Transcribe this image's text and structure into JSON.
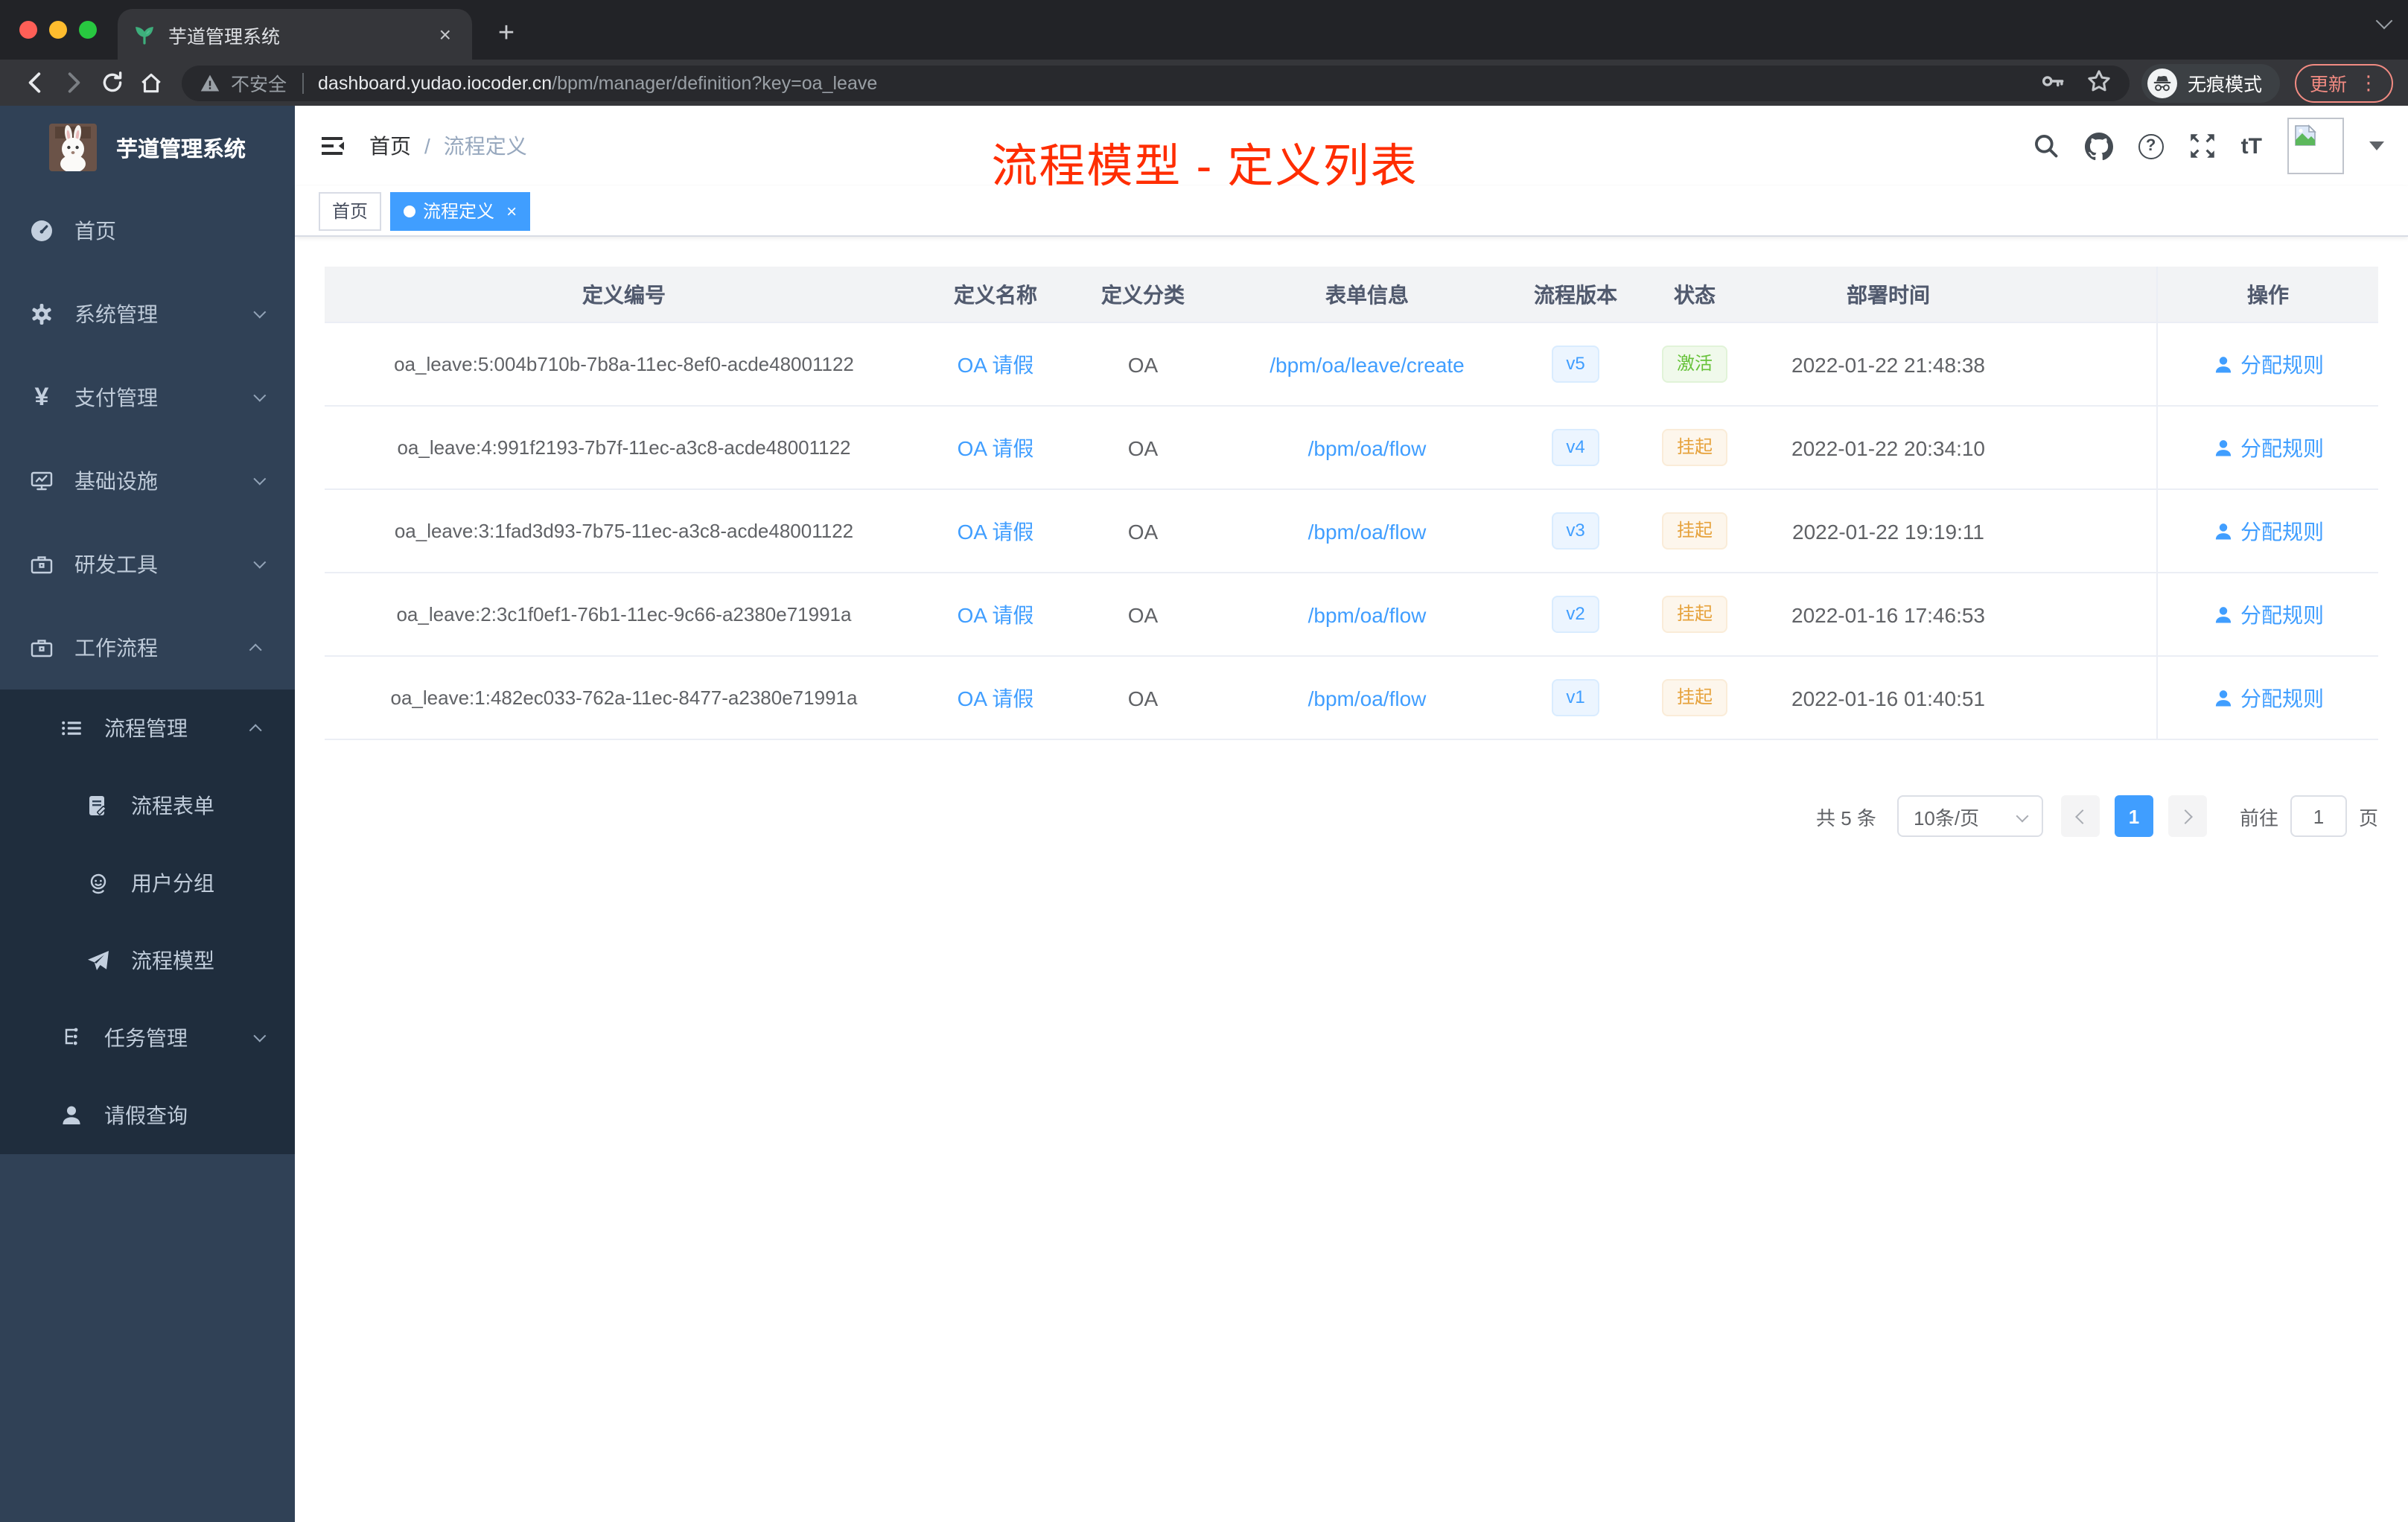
{
  "browser": {
    "tab_title": "芋道管理系统",
    "new_tab_label": "+",
    "close_tab_label": "×",
    "address": {
      "warning_label": "不安全",
      "host": "dashboard.yudao.iocoder.cn",
      "path": "/bpm/manager/definition?key=oa_leave"
    },
    "incognito_label": "无痕模式",
    "update_label": "更新",
    "menu_dots": "⋮"
  },
  "sidebar": {
    "logo_title": "芋道管理系统",
    "items": [
      {
        "label": "首页",
        "icon": "dashboard-icon",
        "level": 1
      },
      {
        "label": "系统管理",
        "icon": "gear-icon",
        "level": 1,
        "chevron": "down"
      },
      {
        "label": "支付管理",
        "icon": "yen-icon",
        "level": 1,
        "chevron": "down"
      },
      {
        "label": "基础设施",
        "icon": "monitor-icon",
        "level": 1,
        "chevron": "down"
      },
      {
        "label": "研发工具",
        "icon": "toolbox-icon",
        "level": 1,
        "chevron": "down"
      },
      {
        "label": "工作流程",
        "icon": "briefcase-icon",
        "level": 1,
        "chevron": "up"
      },
      {
        "label": "流程管理",
        "icon": "list-icon",
        "level": 2,
        "chevron": "up"
      },
      {
        "label": "流程表单",
        "icon": "form-icon",
        "level": 3
      },
      {
        "label": "用户分组",
        "icon": "user-group-icon",
        "level": 3
      },
      {
        "label": "流程模型",
        "icon": "paper-plane-icon",
        "level": 3
      },
      {
        "label": "任务管理",
        "icon": "tasks-icon",
        "level": 2,
        "chevron": "down"
      },
      {
        "label": "请假查询",
        "icon": "person-icon",
        "level": 2
      }
    ]
  },
  "header": {
    "breadcrumb": {
      "home": "首页",
      "separator": "/",
      "current": "流程定义"
    },
    "annotation": "流程模型 - 定义列表"
  },
  "tags": {
    "items": [
      {
        "label": "首页",
        "active": false
      },
      {
        "label": "流程定义",
        "active": true
      }
    ]
  },
  "table": {
    "columns": {
      "id": "定义编号",
      "name": "定义名称",
      "category": "定义分类",
      "form": "表单信息",
      "version": "流程版本",
      "status": "状态",
      "deploy_time": "部署时间",
      "action": "操作"
    },
    "action_label": "分配规则",
    "rows": [
      {
        "id": "oa_leave:5:004b710b-7b8a-11ec-8ef0-acde48001122",
        "name": "OA 请假",
        "category": "OA",
        "form": "/bpm/oa/leave/create",
        "version": "v5",
        "status": {
          "label": "激活",
          "type": "success"
        },
        "time": "2022-01-22 21:48:38"
      },
      {
        "id": "oa_leave:4:991f2193-7b7f-11ec-a3c8-acde48001122",
        "name": "OA 请假",
        "category": "OA",
        "form": "/bpm/oa/flow",
        "version": "v4",
        "status": {
          "label": "挂起",
          "type": "warning"
        },
        "time": "2022-01-22 20:34:10"
      },
      {
        "id": "oa_leave:3:1fad3d93-7b75-11ec-a3c8-acde48001122",
        "name": "OA 请假",
        "category": "OA",
        "form": "/bpm/oa/flow",
        "version": "v3",
        "status": {
          "label": "挂起",
          "type": "warning"
        },
        "time": "2022-01-22 19:19:11"
      },
      {
        "id": "oa_leave:2:3c1f0ef1-76b1-11ec-9c66-a2380e71991a",
        "name": "OA 请假",
        "category": "OA",
        "form": "/bpm/oa/flow",
        "version": "v2",
        "status": {
          "label": "挂起",
          "type": "warning"
        },
        "time": "2022-01-16 17:46:53"
      },
      {
        "id": "oa_leave:1:482ec033-762a-11ec-8477-a2380e71991a",
        "name": "OA 请假",
        "category": "OA",
        "form": "/bpm/oa/flow",
        "version": "v1",
        "status": {
          "label": "挂起",
          "type": "warning"
        },
        "time": "2022-01-16 01:40:51"
      }
    ]
  },
  "pagination": {
    "total": "共 5 条",
    "page_size": "10条/页",
    "page": "1",
    "goto": "前往",
    "goto_value": "1",
    "unit": "页"
  },
  "colors": {
    "accent": "#409eff",
    "annotation": "#ff2d00",
    "sidebar_bg": "#304156",
    "submenu_bg": "#1f2d3d",
    "success": "#67c23a",
    "warning": "#e6a23c"
  }
}
